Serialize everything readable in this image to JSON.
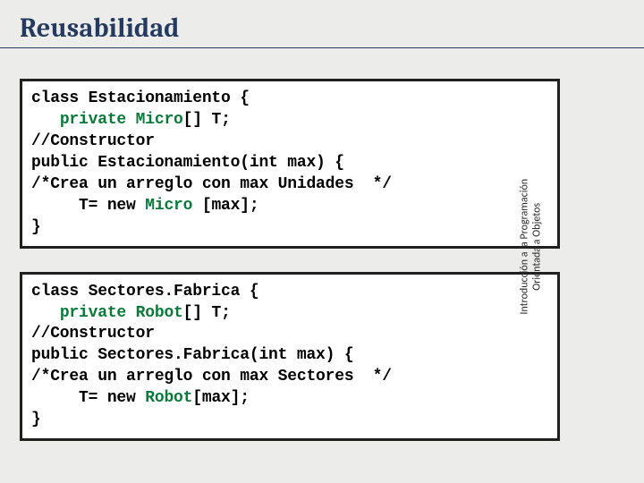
{
  "title": "Reusabilidad",
  "side_label_line1": "Introducción a la Programación",
  "side_label_line2": "Orientada a Objetos",
  "code1": {
    "l1a": "class Estacionamiento {",
    "l2a": "   ",
    "l2b": "private",
    "l2c": " ",
    "l2d": "Micro",
    "l2e": "[] T;",
    "l3": "//Constructor",
    "l4": "public Estacionamiento(int max) {",
    "l5": "/*Crea un arreglo con max Unidades  */",
    "l6a": "     T= new ",
    "l6b": "Micro",
    "l6c": " [max];",
    "l7": "}"
  },
  "code2": {
    "l1a": "class Sectores.Fabrica {",
    "l2a": "   ",
    "l2b": "private",
    "l2c": " ",
    "l2d": "Robot",
    "l2e": "[] T;",
    "l3": "//Constructor",
    "l4": "public Sectores.Fabrica(int max) {",
    "l5": "/*Crea un arreglo con max Sectores  */",
    "l6a": "     T= new ",
    "l6b": "Robot",
    "l6c": "[max];",
    "l7": "}"
  }
}
